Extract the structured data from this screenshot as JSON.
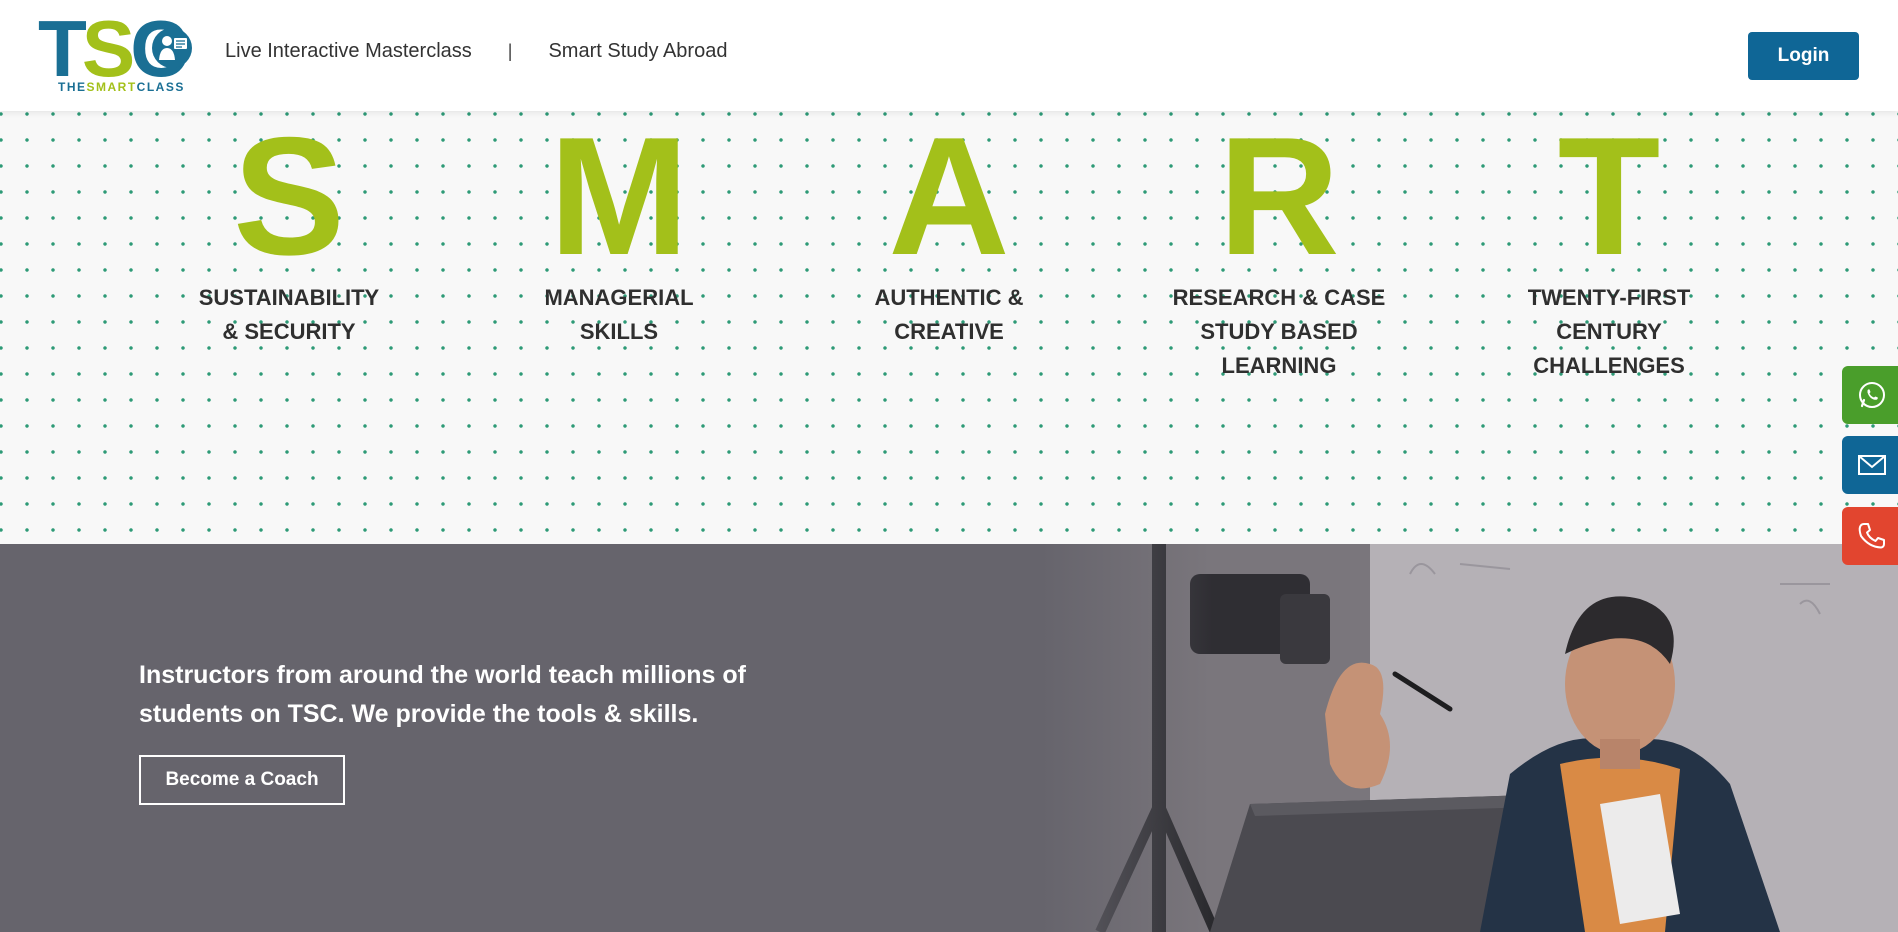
{
  "header": {
    "logo": {
      "letters": [
        "T",
        "S",
        "C"
      ],
      "tagline_parts": [
        "THE",
        "SMART",
        "CLASS"
      ]
    },
    "nav": [
      {
        "label": "Live Interactive Masterclass"
      },
      {
        "label": "Smart Study Abroad"
      }
    ],
    "separator": "|",
    "login_label": "Login"
  },
  "smart": {
    "pillars": [
      {
        "letter": "S",
        "words": "Sustainability\n& Security"
      },
      {
        "letter": "M",
        "words": "Managerial\nSkills"
      },
      {
        "letter": "A",
        "words": "Authentic &\nCreative"
      },
      {
        "letter": "R",
        "words": "Research & Case\nStudy Based\nLearning"
      },
      {
        "letter": "T",
        "words": "Twenty-First\nCentury\nChallenges"
      }
    ]
  },
  "contact": {
    "icons": [
      "whatsapp-icon",
      "mail-icon",
      "phone-icon"
    ]
  },
  "hero": {
    "text": "Instructors from around the world teach millions of students on TSC. We provide the tools & skills.",
    "cta_label": "Become a Coach"
  },
  "colors": {
    "brand_blue": "#0f6696",
    "brand_green": "#a3c01a",
    "whatsapp_green": "#4a9e2b",
    "phone_red": "#e2452f",
    "hero_bg": "#66646c"
  }
}
